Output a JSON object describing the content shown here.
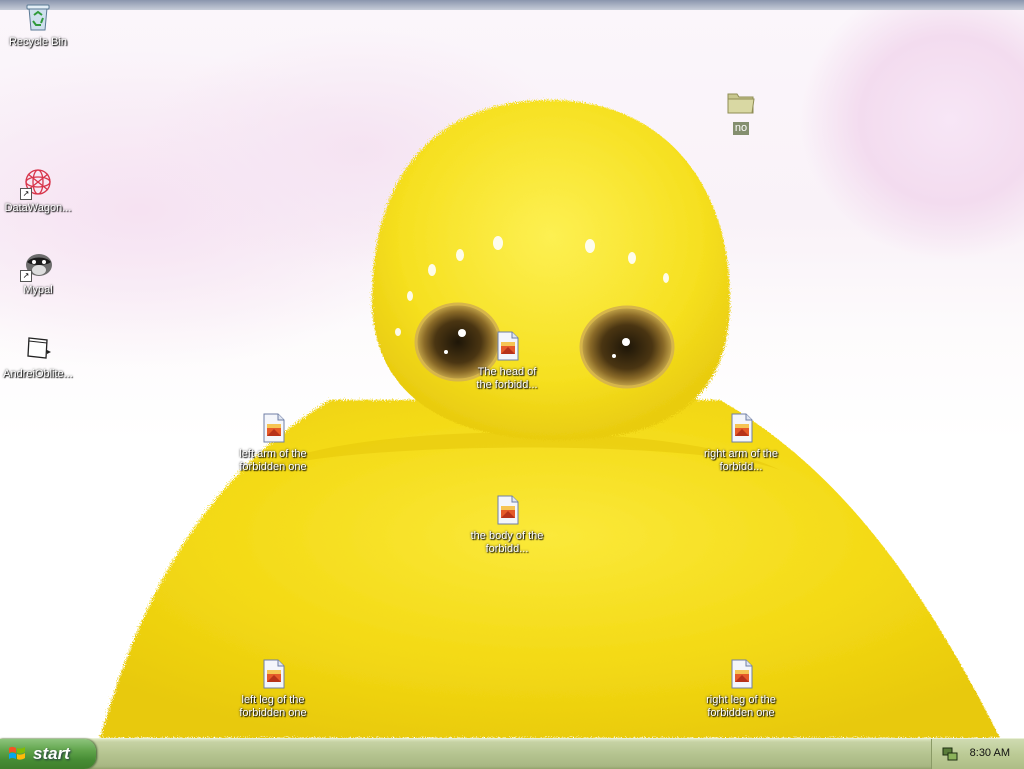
{
  "desktop": {
    "icons": [
      {
        "label": "Recycle Bin",
        "icon": "recycle-bin-icon"
      },
      {
        "label": "DataWagon...",
        "icon": "datawagon-icon"
      },
      {
        "label": "Mypal",
        "icon": "mypal-icon"
      },
      {
        "label": "AndreiOblite...",
        "icon": "window-shortcut-icon"
      },
      {
        "label": "no",
        "icon": "folder-icon"
      },
      {
        "label": "The head of the forbidd...",
        "icon": "image-file-icon"
      },
      {
        "label": "left arm of the forbidden one",
        "icon": "image-file-icon"
      },
      {
        "label": "right arm of the forbidd...",
        "icon": "image-file-icon"
      },
      {
        "label": "the body of the forbidd...",
        "icon": "image-file-icon"
      },
      {
        "label": "left leg of the forbidden one",
        "icon": "image-file-icon"
      },
      {
        "label": "right leg of the forbidden one",
        "icon": "image-file-icon"
      }
    ]
  },
  "taskbar": {
    "start_label": "start",
    "clock": "8:30 AM"
  },
  "colors": {
    "creature": "#f5e01c",
    "taskbar": "#b5c490",
    "start_button": "#468c34"
  }
}
